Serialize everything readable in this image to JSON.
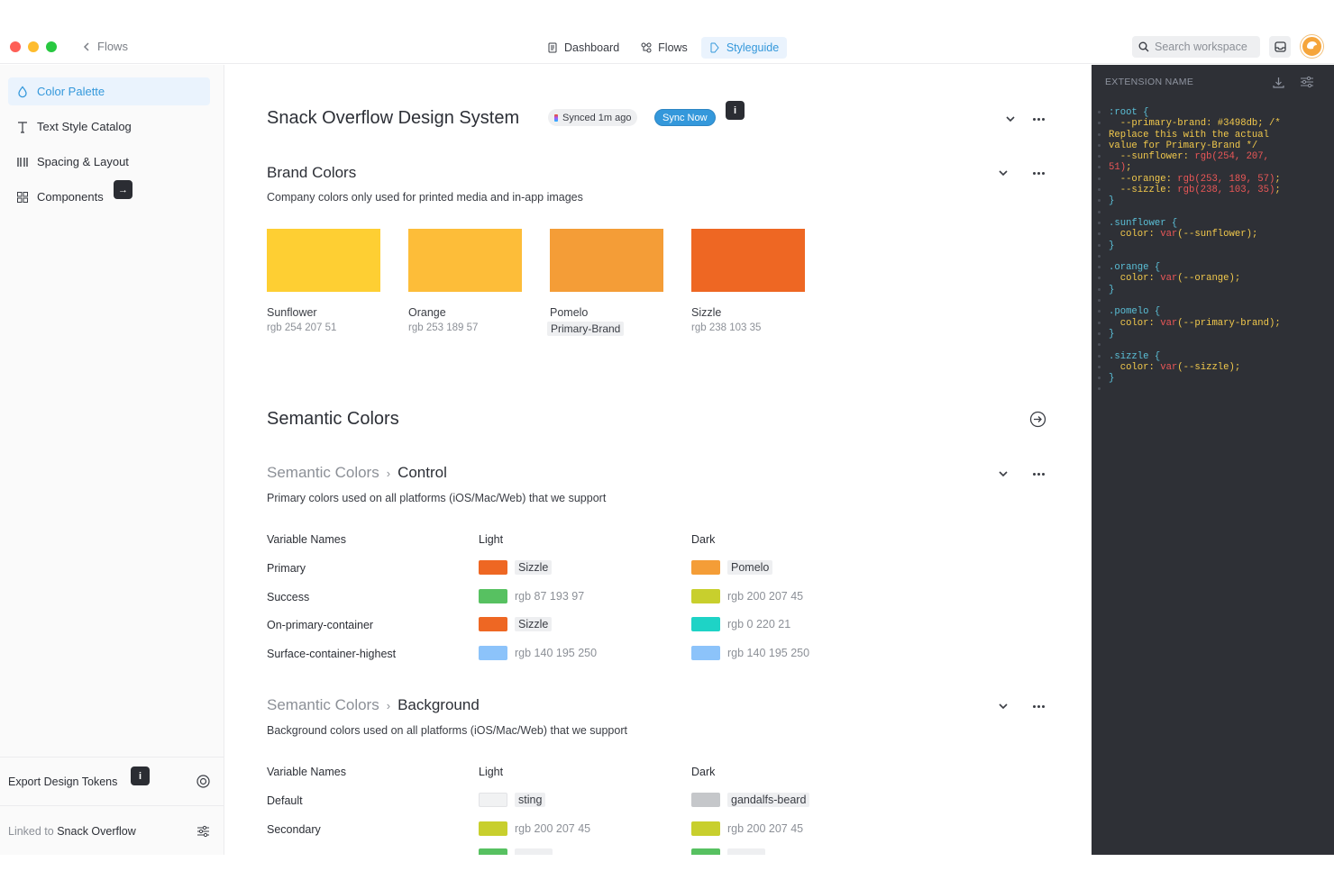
{
  "topbar": {
    "back_label": "Flows",
    "tabs": [
      {
        "label": "Dashboard",
        "icon": "document-icon",
        "active": false
      },
      {
        "label": "Flows",
        "icon": "flow-icon",
        "active": false
      },
      {
        "label": "Styleguide",
        "icon": "styleguide-icon",
        "active": true
      }
    ],
    "search_placeholder": "Search workspace",
    "accent": "#3498db"
  },
  "sidebar": {
    "items": [
      {
        "label": "Color Palette",
        "icon": "droplet-icon",
        "active": true
      },
      {
        "label": "Text Style Catalog",
        "icon": "text-icon",
        "active": false
      },
      {
        "label": "Spacing & Layout",
        "icon": "spacing-icon",
        "active": false
      },
      {
        "label": "Components",
        "icon": "components-icon",
        "active": false
      }
    ],
    "components_chip": "→",
    "footer": {
      "export_label": "Export Design Tokens",
      "info_chip": "i",
      "linked_prefix": "Linked to",
      "linked_name": "Snack Overflow"
    }
  },
  "main": {
    "title": "Snack Overflow Design System",
    "synced_badge": "Synced 1m ago",
    "sync_button": "Sync Now",
    "info_chip": "i",
    "brand": {
      "title": "Brand Colors",
      "description": "Company colors only used for printed media and in-app images",
      "swatches": [
        {
          "name": "Sunflower",
          "value": "rgb 254 207 51",
          "color": "#fecf33",
          "is_ref": false
        },
        {
          "name": "Orange",
          "value": "rgb 253 189 57",
          "color": "#fdbd39",
          "is_ref": false
        },
        {
          "name": "Pomelo",
          "value": "Primary-Brand",
          "color": "#f49d37",
          "is_ref": true
        },
        {
          "name": "Sizzle",
          "value": "rgb 238 103 35",
          "color": "#ee6723",
          "is_ref": false
        }
      ]
    },
    "semantic": {
      "title": "Semantic Colors",
      "control": {
        "crumb_root": "Semantic Colors",
        "crumb_leaf": "Control",
        "description": "Primary colors used on all platforms (iOS/Mac/Web) that we support",
        "headers": [
          "Variable Names",
          "Light",
          "Dark"
        ],
        "rows": [
          {
            "name": "Primary",
            "light": {
              "label": "Sizzle",
              "color": "#ee6723",
              "is_ref": true
            },
            "dark": {
              "label": "Pomelo",
              "color": "#f49d37",
              "is_ref": true
            }
          },
          {
            "name": "Success",
            "light": {
              "label": "rgb 87 193 97",
              "color": "#57c161",
              "is_ref": false
            },
            "dark": {
              "label": "rgb 200 207 45",
              "color": "#c8cf2d",
              "is_ref": false
            }
          },
          {
            "name": "On-primary-container",
            "light": {
              "label": "Sizzle",
              "color": "#ee6723",
              "is_ref": true
            },
            "dark": {
              "label": "rgb 0 220 21",
              "color": "#1ed3c6",
              "is_ref": false
            }
          },
          {
            "name": "Surface-container-highest",
            "light": {
              "label": "rgb 140 195 250",
              "color": "#8cc3fa",
              "is_ref": false
            },
            "dark": {
              "label": "rgb 140 195 250",
              "color": "#8cc3fa",
              "is_ref": false
            }
          }
        ]
      },
      "background": {
        "crumb_root": "Semantic Colors",
        "crumb_leaf": "Background",
        "description": "Background colors used on all platforms (iOS/Mac/Web) that we support",
        "headers": [
          "Variable Names",
          "Light",
          "Dark"
        ],
        "rows": [
          {
            "name": "Default",
            "light": {
              "label": "sting",
              "color": "#f1f2f3",
              "is_ref": true
            },
            "dark": {
              "label": "gandalfs-beard",
              "color": "#c5c7ca",
              "is_ref": true
            }
          },
          {
            "name": "Secondary",
            "light": {
              "label": "rgb 200 207 45",
              "color": "#c8cf2d",
              "is_ref": false
            },
            "dark": {
              "label": "rgb 200 207 45",
              "color": "#c8cf2d",
              "is_ref": false
            }
          }
        ]
      }
    }
  },
  "code_panel": {
    "title": "EXTENSION NAME",
    "lines": [
      [
        [
          "c-sel",
          ":root {"
        ],
        [
          "c-prop",
          ""
        ]
      ],
      [
        [
          "c-prop",
          "  --primary-brand: #3498db; /*"
        ]
      ],
      [
        [
          "c-prop",
          "Replace this with the actual"
        ]
      ],
      [
        [
          "c-prop",
          "value for Primary-Brand */"
        ]
      ],
      [
        [
          "c-prop",
          "  --sunflower: "
        ],
        [
          "c-fn",
          "rgb(254, 207,"
        ]
      ],
      [
        [
          "c-fn",
          "51)"
        ],
        [
          "c-prop",
          ";"
        ]
      ],
      [
        [
          "c-prop",
          "  --orange: "
        ],
        [
          "c-fn",
          "rgb(253, 189, 57)"
        ],
        [
          "c-prop",
          ";"
        ]
      ],
      [
        [
          "c-prop",
          "  --sizzle: "
        ],
        [
          "c-fn",
          "rgb(238, 103, 35)"
        ],
        [
          "c-prop",
          ";"
        ]
      ],
      [
        [
          "c-sel",
          "}"
        ]
      ],
      [
        [
          "c-sel",
          ""
        ]
      ],
      [
        [
          "c-sel",
          ".sunflower {"
        ]
      ],
      [
        [
          "c-prop",
          "  color: "
        ],
        [
          "c-fn",
          "var"
        ],
        [
          "c-prop",
          "(--sunflower);"
        ]
      ],
      [
        [
          "c-sel",
          "}"
        ]
      ],
      [
        [
          "c-sel",
          ""
        ]
      ],
      [
        [
          "c-sel",
          ".orange {"
        ]
      ],
      [
        [
          "c-prop",
          "  color: "
        ],
        [
          "c-fn",
          "var"
        ],
        [
          "c-prop",
          "(--orange);"
        ]
      ],
      [
        [
          "c-sel",
          "}"
        ]
      ],
      [
        [
          "c-sel",
          ""
        ]
      ],
      [
        [
          "c-sel",
          ".pomelo {"
        ]
      ],
      [
        [
          "c-prop",
          "  color: "
        ],
        [
          "c-fn",
          "var"
        ],
        [
          "c-prop",
          "(--primary-brand);"
        ]
      ],
      [
        [
          "c-sel",
          "}"
        ]
      ],
      [
        [
          "c-sel",
          ""
        ]
      ],
      [
        [
          "c-sel",
          ".sizzle {"
        ]
      ],
      [
        [
          "c-prop",
          "  color: "
        ],
        [
          "c-fn",
          "var"
        ],
        [
          "c-prop",
          "(--sizzle);"
        ]
      ],
      [
        [
          "c-sel",
          "}"
        ]
      ]
    ]
  }
}
